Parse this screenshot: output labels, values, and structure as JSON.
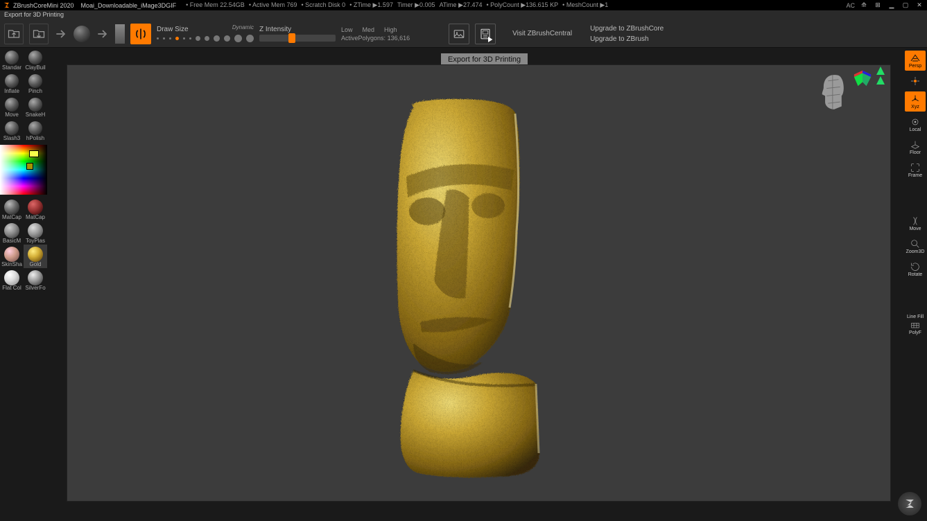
{
  "titlebar": {
    "app": "ZBrushCoreMini 2020",
    "file": "Moai_Downloadable_iMage3DGIF",
    "stats": {
      "free_mem": "Free Mem 22.54GB",
      "active_mem": "Active Mem 769",
      "scratch": "Scratch Disk 0",
      "ztime": "ZTime ▶1.597",
      "timer": "Timer ▶0.005",
      "atime": "ATime ▶27.474",
      "polycount": "PolyCount ▶136.615 KP",
      "meshcount": "MeshCount ▶1"
    },
    "ac": "AC"
  },
  "statusline": "Export for 3D Printing",
  "shelf": {
    "draw_size": "Draw Size",
    "dynamic": "Dynamic",
    "z_intensity": "Z Intensity",
    "low": "Low",
    "med": "Med",
    "high": "High",
    "active_poly_label": "ActivePolygons:",
    "active_poly_count": "136,616",
    "visit": "Visit ZBrushCentral",
    "upgrade_core": "Upgrade to ZBrushCore",
    "upgrade_full": "Upgrade to ZBrush"
  },
  "tooltip": "Export for 3D Printing",
  "brushes": [
    {
      "label": "Standar"
    },
    {
      "label": "ClayBuil"
    },
    {
      "label": "Inflate"
    },
    {
      "label": "Pinch"
    },
    {
      "label": "Move"
    },
    {
      "label": "SnakeH"
    },
    {
      "label": "Slash3"
    },
    {
      "label": "hPolish"
    }
  ],
  "materials": [
    {
      "label": "MatCap",
      "cls": "m-gray"
    },
    {
      "label": "MatCap",
      "cls": "m-red"
    },
    {
      "label": "BasicM",
      "cls": "m-light"
    },
    {
      "label": "ToyPlas",
      "cls": "m-toy"
    },
    {
      "label": "SkinSha",
      "cls": "m-skin"
    },
    {
      "label": "Gold",
      "cls": "m-gold",
      "sel": true
    },
    {
      "label": "Flat Col",
      "cls": "m-white"
    },
    {
      "label": "SilverFo",
      "cls": "m-silver"
    }
  ],
  "rightpanel": {
    "persp": "Persp",
    "xyz": "Xyz",
    "local": "Local",
    "floor": "Floor",
    "frame": "Frame",
    "move": "Move",
    "zoom": "Zoom3D",
    "rotate": "Rotate",
    "linefill": "Line Fill",
    "polyf": "PolyF"
  }
}
